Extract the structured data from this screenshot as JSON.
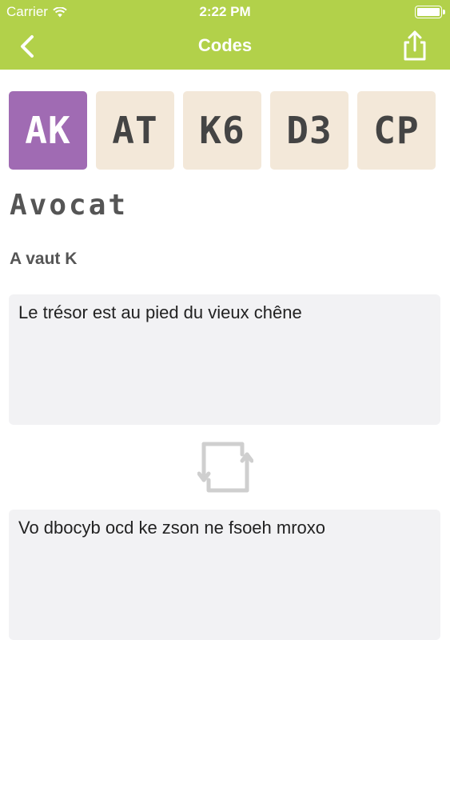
{
  "status_bar": {
    "carrier": "Carrier",
    "time": "2:22 PM"
  },
  "nav": {
    "title": "Codes",
    "back_icon": "chevron-left-icon",
    "share_icon": "share-icon"
  },
  "codes": [
    {
      "label": "AK",
      "active": true
    },
    {
      "label": "AT",
      "active": false
    },
    {
      "label": "K6",
      "active": false
    },
    {
      "label": "D3",
      "active": false
    },
    {
      "label": "CP",
      "active": false
    }
  ],
  "code_name": "Avocat",
  "code_rule": "A vaut K",
  "input_text": "Le trésor est au pied du vieux chêne",
  "output_text": "Vo dbocyb ocd ke zson ne fsoeh mroxo",
  "colors": {
    "header": "#b2d14a",
    "active_tab": "#a06bb3",
    "inactive_tab": "#f3e8d9",
    "text_box": "#f2f2f4"
  }
}
